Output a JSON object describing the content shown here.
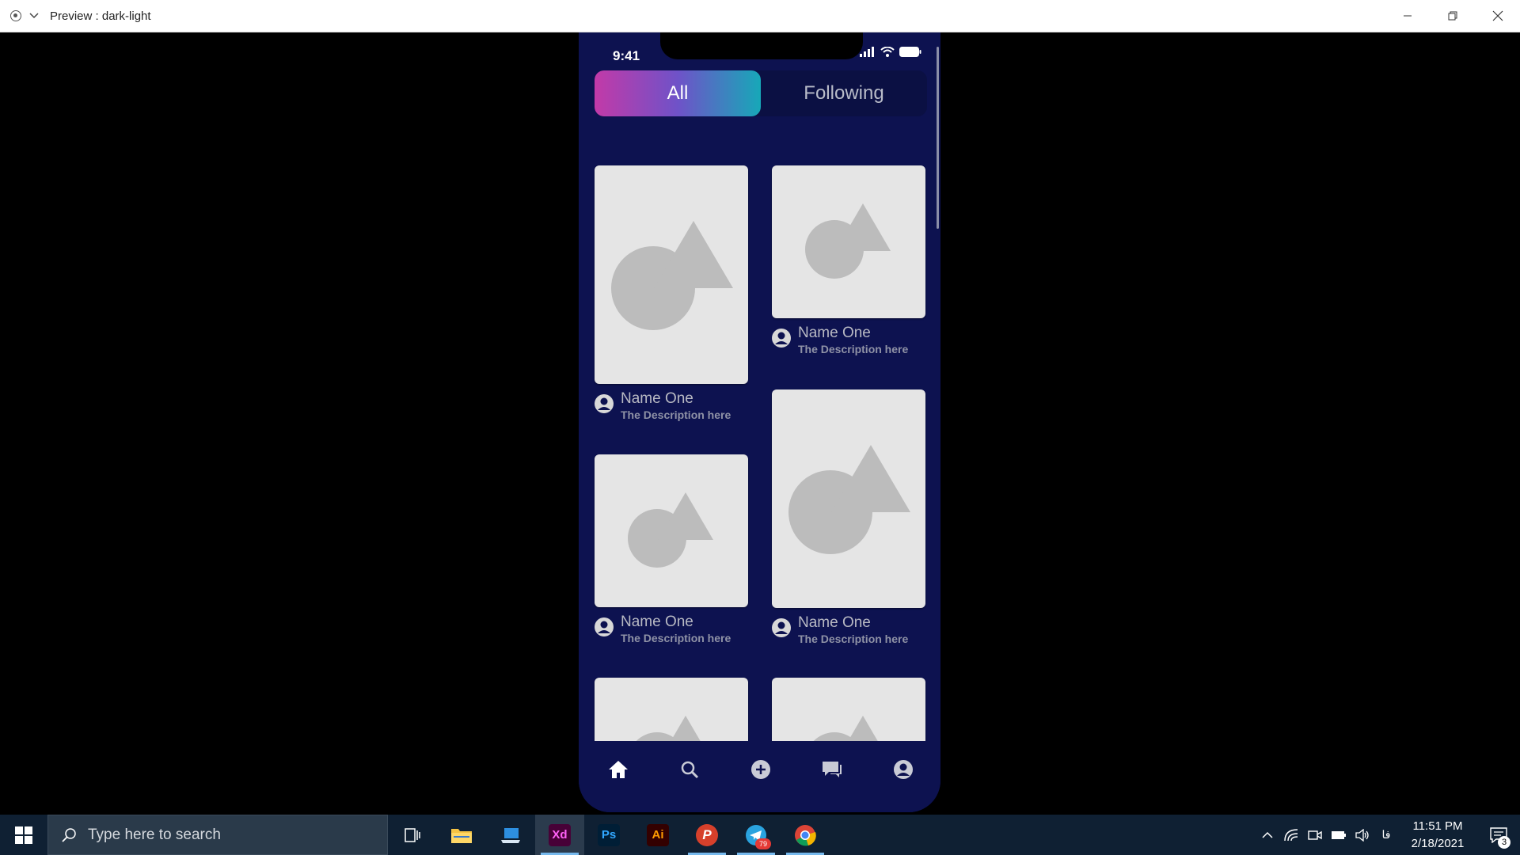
{
  "window": {
    "title": "Preview : dark-light"
  },
  "phone": {
    "status_time": "9:41",
    "tabs": [
      {
        "label": "All",
        "active": true
      },
      {
        "label": "Following",
        "active": false
      }
    ],
    "cards": [
      {
        "name": "Name One",
        "description": "The Description here"
      },
      {
        "name": "Name One",
        "description": "The Description here"
      },
      {
        "name": "Name One",
        "description": "The Description here"
      },
      {
        "name": "Name One",
        "description": "The Description here"
      },
      {
        "name": "",
        "description": ""
      },
      {
        "name": "",
        "description": ""
      }
    ],
    "nav": [
      "home-icon",
      "search-icon",
      "add-circle-icon",
      "chat-icon",
      "profile-icon"
    ],
    "colors": {
      "background": "#0d1250",
      "card": "#e5e5e5",
      "tab_gradient": [
        "#c23aa8",
        "#17a8b8"
      ]
    }
  },
  "taskbar": {
    "search_placeholder": "Type here to search",
    "apps": [
      {
        "name": "task-view",
        "label": ""
      },
      {
        "name": "file-explorer",
        "label": ""
      },
      {
        "name": "desktop-app",
        "label": ""
      },
      {
        "name": "adobe-xd",
        "label": "Xd",
        "active": true
      },
      {
        "name": "photoshop",
        "label": "Ps"
      },
      {
        "name": "illustrator",
        "label": "Ai"
      },
      {
        "name": "p-app",
        "label": "P"
      },
      {
        "name": "telegram",
        "label": "",
        "badge": "79"
      },
      {
        "name": "chrome",
        "label": ""
      }
    ],
    "lang": "فا",
    "time": "11:51 PM",
    "date": "2/18/2021",
    "notifications": "3"
  }
}
